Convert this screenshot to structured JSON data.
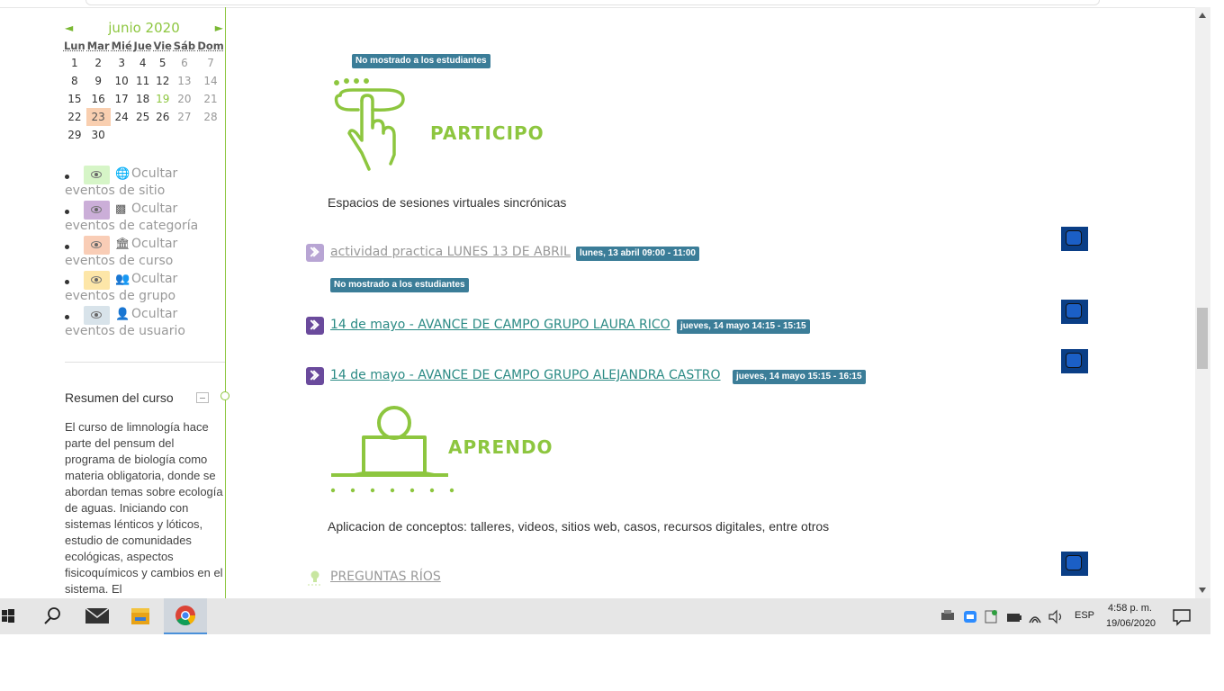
{
  "calendar": {
    "month_title": "junio 2020",
    "prev": "◄",
    "next": "►",
    "weekdays": [
      "Lun",
      "Mar",
      "Mié",
      "Jue",
      "Vie",
      "Sáb",
      "Dom"
    ],
    "weeks": [
      [
        "1",
        "2",
        "3",
        "4",
        "5",
        "6",
        "7"
      ],
      [
        "8",
        "9",
        "10",
        "11",
        "12",
        "13",
        "14"
      ],
      [
        "15",
        "16",
        "17",
        "18",
        "19",
        "20",
        "21"
      ],
      [
        "22",
        "23",
        "24",
        "25",
        "26",
        "27",
        "28"
      ],
      [
        "29",
        "30",
        "",
        "",
        "",
        "",
        ""
      ]
    ]
  },
  "filters": [
    {
      "line1": "Ocultar",
      "line2": "eventos de sitio",
      "icon": "globe-icon",
      "color": "#d6f5c7"
    },
    {
      "line1": "Ocultar",
      "line2": "eventos de categoría",
      "icon": "cubes-icon",
      "color": "#cbaed8"
    },
    {
      "line1": "Ocultar",
      "line2": "eventos de curso",
      "icon": "institution-icon",
      "color": "#f9cdb6"
    },
    {
      "line1": "Ocultar",
      "line2": "eventos de grupo",
      "icon": "users-icon",
      "color": "#fde6a8"
    },
    {
      "line1": "Ocultar",
      "line2": "eventos de usuario",
      "icon": "user-icon",
      "color": "#d8e3ea"
    }
  ],
  "summary": {
    "title": "Resumen del curso",
    "text": "El curso de limnología hace parte del pensum del programa de biología como materia obligatoria, donde se abordan temas sobre ecología de aguas. Iniciando con sistemas lénticos y lóticos, estudio de comunidades ecológicas, aspectos fisicoquímicos y cambios en el sistema. El"
  },
  "main": {
    "badge_hidden": "No mostrado a los estudiantes",
    "participo": {
      "word": "PARTICIPO",
      "desc": "Espacios de sesiones virtuales sincrónicas"
    },
    "activities": [
      {
        "title": "actividad practica LUNES 13 DE ABRIL",
        "date": "lunes, 13 abril 09:00 - 11:00"
      },
      {
        "title": "14 de mayo - AVANCE DE CAMPO GRUPO LAURA RICO",
        "date": "jueves, 14 mayo 14:15 - 15:15"
      },
      {
        "title": "14 de mayo - AVANCE DE CAMPO GRUPO ALEJANDRA CASTRO",
        "date": "jueves, 14 mayo 15:15 - 16:15"
      }
    ],
    "aprendo": {
      "word": "APRENDO",
      "desc": "Aplicacion de conceptos: talleres, videos, sitios web, casos, recursos digitales, entre otros"
    },
    "preguntas": "PREGUNTAS RÍOS"
  },
  "taskbar": {
    "lang": "ESP",
    "time": "4:58 p. m.",
    "date": "19/06/2020"
  },
  "colors": {
    "accent": "#8dc63f",
    "badge": "#3b7d98",
    "link_teal": "#2a8a84"
  }
}
